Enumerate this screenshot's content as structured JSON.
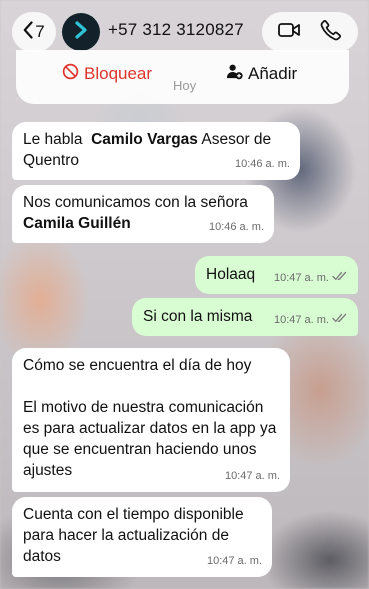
{
  "header": {
    "back_count": "7",
    "contact": "+57 312 3120827",
    "block_label": "Bloquear",
    "add_label": "Añadir",
    "date_divider": "Hoy"
  },
  "messages": [
    {
      "dir": "in",
      "parts": [
        {
          "t": "Le habla  ",
          "b": false
        },
        {
          "t": "Camilo Vargas",
          "b": true
        },
        {
          "t": " Asesor de Quentro",
          "b": false
        }
      ],
      "time": "10:46 a. m."
    },
    {
      "dir": "in",
      "parts": [
        {
          "t": "Nos comunicamos con la señora ",
          "b": false
        },
        {
          "t": "Camila Guillén",
          "b": true
        }
      ],
      "time": "10:46 a. m."
    },
    {
      "dir": "out",
      "parts": [
        {
          "t": "Holaaq",
          "b": false
        }
      ],
      "time": "10:47 a. m."
    },
    {
      "dir": "out",
      "parts": [
        {
          "t": "Si con la misma",
          "b": false
        }
      ],
      "time": "10:47 a. m."
    },
    {
      "dir": "in",
      "parts": [
        {
          "t": "Cómo se encuentra el día de hoy\n\nEl motivo de nuestra comunicación es para actualizar datos en la app ya que se encuentran haciendo unos ajustes",
          "b": false
        }
      ],
      "time": "10:47 a. m."
    },
    {
      "dir": "in",
      "parts": [
        {
          "t": "Cuenta con el tiempo disponible para hacer la actualización de datos",
          "b": false
        }
      ],
      "time": "10:47 a. m."
    }
  ],
  "colors": {
    "block_red": "#e0342c",
    "outgoing_bubble": "#d9fdd3",
    "incoming_bubble": "#ffffff",
    "read_tick": "#7a7a7a"
  },
  "icons": [
    "back-chevron-icon",
    "avatar-arrow-icon",
    "video-call-icon",
    "phone-icon",
    "block-icon",
    "add-contact-icon",
    "double-check-icon"
  ]
}
